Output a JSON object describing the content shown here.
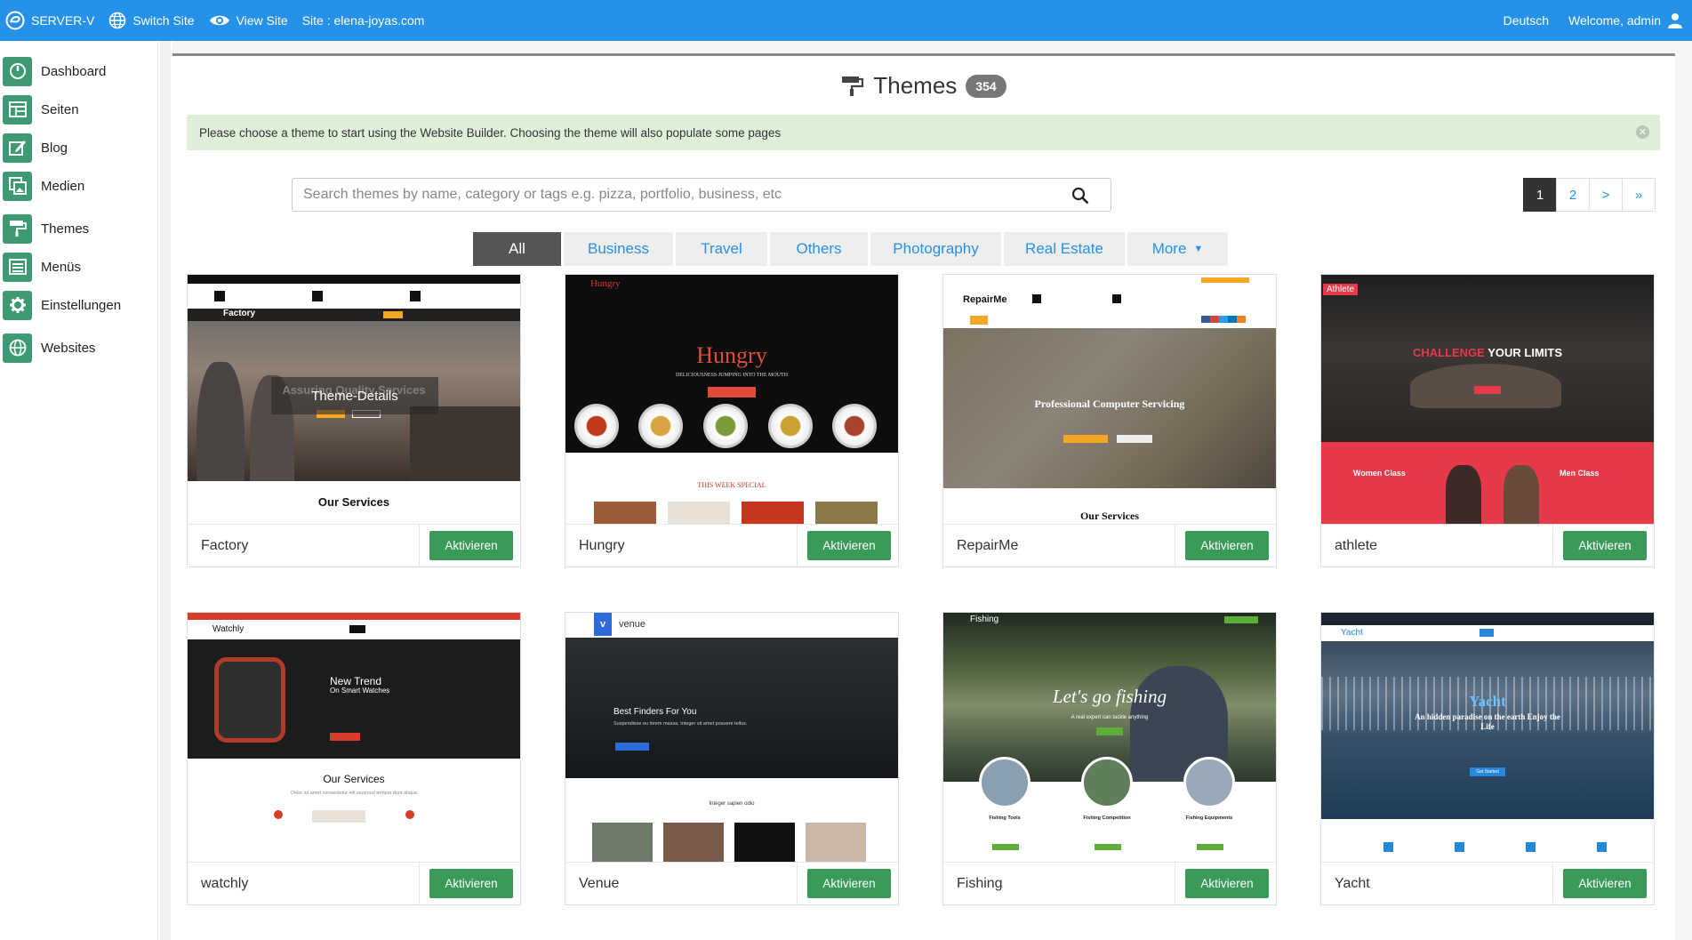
{
  "topbar": {
    "brand": "SERVER-V",
    "switch_site": "Switch Site",
    "view_site": "View Site",
    "site_label": "Site : elena-joyas.com",
    "language": "Deutsch",
    "welcome": "Welcome, admin"
  },
  "sidebar": {
    "items": [
      {
        "label": "Dashboard",
        "icon": "dashboard-icon"
      },
      {
        "label": "Seiten",
        "icon": "pages-icon"
      },
      {
        "label": "Blog",
        "icon": "blog-edit-icon"
      },
      {
        "label": "Medien",
        "icon": "media-icon"
      },
      {
        "label": "Themes",
        "icon": "paint-roller-icon"
      },
      {
        "label": "Menüs",
        "icon": "menu-list-icon"
      },
      {
        "label": "Einstellungen",
        "icon": "gear-icon"
      },
      {
        "label": "Websites",
        "icon": "globe-icon"
      }
    ]
  },
  "page": {
    "title": "Themes",
    "count": "354",
    "alert": "Please choose a theme to start using the Website Builder. Choosing the theme will also populate some pages",
    "search_placeholder": "Search themes by name, category or tags e.g. pizza, portfolio, business, etc"
  },
  "pagination": [
    "1",
    "2",
    ">",
    "»"
  ],
  "tabs": [
    "All",
    "Business",
    "Travel",
    "Others",
    "Photography",
    "Real Estate",
    "More"
  ],
  "activate_label": "Aktivieren",
  "overlay_label": "Theme-Details",
  "themes": [
    {
      "name": "Factory",
      "logo": "Factory",
      "hero": "Assuring Quality Services",
      "section": "Our Services"
    },
    {
      "name": "Hungry",
      "logo": "Hungry",
      "hero": "Hungry",
      "sub": "DELICIOUSNESS JUMPING INTO THE MOUTH",
      "section": "THIS WEEK SPECIAL"
    },
    {
      "name": "RepairMe",
      "logo": "RepairMe",
      "hero": "Professional Computer Servicing",
      "section": "Our Services"
    },
    {
      "name": "athlete",
      "logo": "Athlete",
      "hero_a": "CHALLENGE",
      "hero_b": " YOUR LIMITS",
      "col_a": "Women Class",
      "col_b": "Men Class"
    },
    {
      "name": "watchly",
      "logo": "Watchly",
      "hero": "New Trend",
      "sub": "On Smart Watches",
      "section": "Our Services",
      "section_sub": "Dolor sit amet consectetur elit eiusmod tempor dunt aliqua"
    },
    {
      "name": "Venue",
      "logo": "venue",
      "hero": "Best Finders For You",
      "sub": "Suspendisse eu lorem massa. Integer sit amet posuere tellus.",
      "section": "Integer sapien odio"
    },
    {
      "name": "Fishing",
      "logo": "Fishing",
      "hero": "Let's go fishing",
      "sub": "A real expert can tackle anything",
      "col_a": "Fishing Tools",
      "col_b": "Fishing Competition",
      "col_c": "Fishing Equipments"
    },
    {
      "name": "Yacht",
      "logo": "Yacht",
      "hero": "Yacht",
      "sub": "An hidden paradise on the earth Enjoy the Life",
      "cta": "Get Started"
    }
  ],
  "colors": {
    "topbar": "#2591e8",
    "sidebar_icon": "#3d9a73",
    "activate_button": "#3a9a57",
    "alert_bg": "#dff0d8",
    "active_tab": "#555555"
  }
}
